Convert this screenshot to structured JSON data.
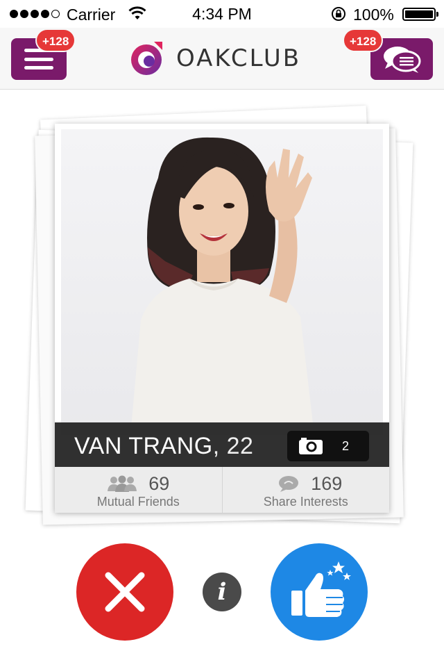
{
  "status_bar": {
    "carrier": "Carrier",
    "time": "4:34 PM",
    "battery_percent": "100%",
    "signal_bars_filled": 4,
    "signal_bars_total": 5
  },
  "header": {
    "app_name": "OAKCLUB",
    "menu_badge": "+128",
    "chat_badge": "+128",
    "brand_color": "#7a1a6a",
    "badge_color": "#e63838"
  },
  "profile": {
    "name": "VAN TRANG",
    "age_suffix": ", 22",
    "photo_count": "2",
    "mutual_friends_count": "69",
    "mutual_friends_label": "Mutual Friends",
    "share_interests_count": "169",
    "share_interests_label": "Share Interests"
  },
  "actions": {
    "reject_icon": "close-icon",
    "info_label": "i",
    "like_icon": "thumbs-up-icon",
    "reject_color": "#dc2626",
    "like_color": "#1e88e5"
  }
}
